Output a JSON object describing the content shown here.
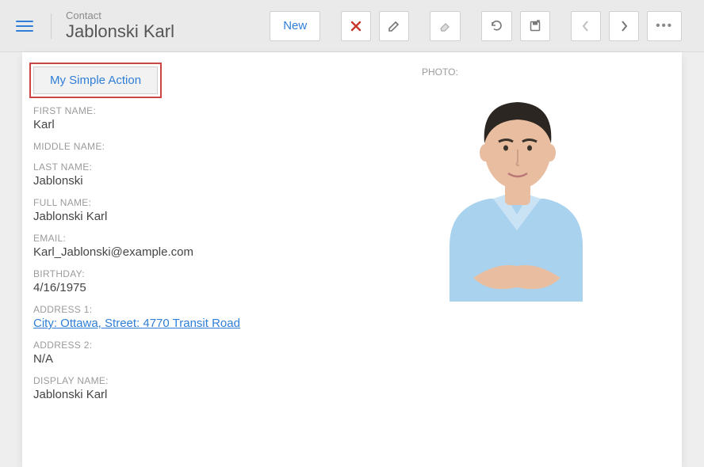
{
  "header": {
    "breadcrumb": "Contact",
    "title": "Jablonski Karl",
    "new_label": "New"
  },
  "actions": {
    "custom": "My Simple Action"
  },
  "fields": {
    "first_name_label": "FIRST NAME:",
    "first_name": "Karl",
    "middle_name_label": "MIDDLE NAME:",
    "middle_name": "",
    "last_name_label": "LAST NAME:",
    "last_name": "Jablonski",
    "full_name_label": "FULL NAME:",
    "full_name": "Jablonski Karl",
    "email_label": "EMAIL:",
    "email": "Karl_Jablonski@example.com",
    "birthday_label": "BIRTHDAY:",
    "birthday": "4/16/1975",
    "address1_label": "ADDRESS 1:",
    "address1": "City: Ottawa, Street: 4770 Transit Road",
    "address2_label": "ADDRESS 2:",
    "address2": "N/A",
    "display_name_label": "DISPLAY NAME:",
    "display_name": "Jablonski Karl"
  },
  "photo": {
    "label": "PHOTO:"
  }
}
